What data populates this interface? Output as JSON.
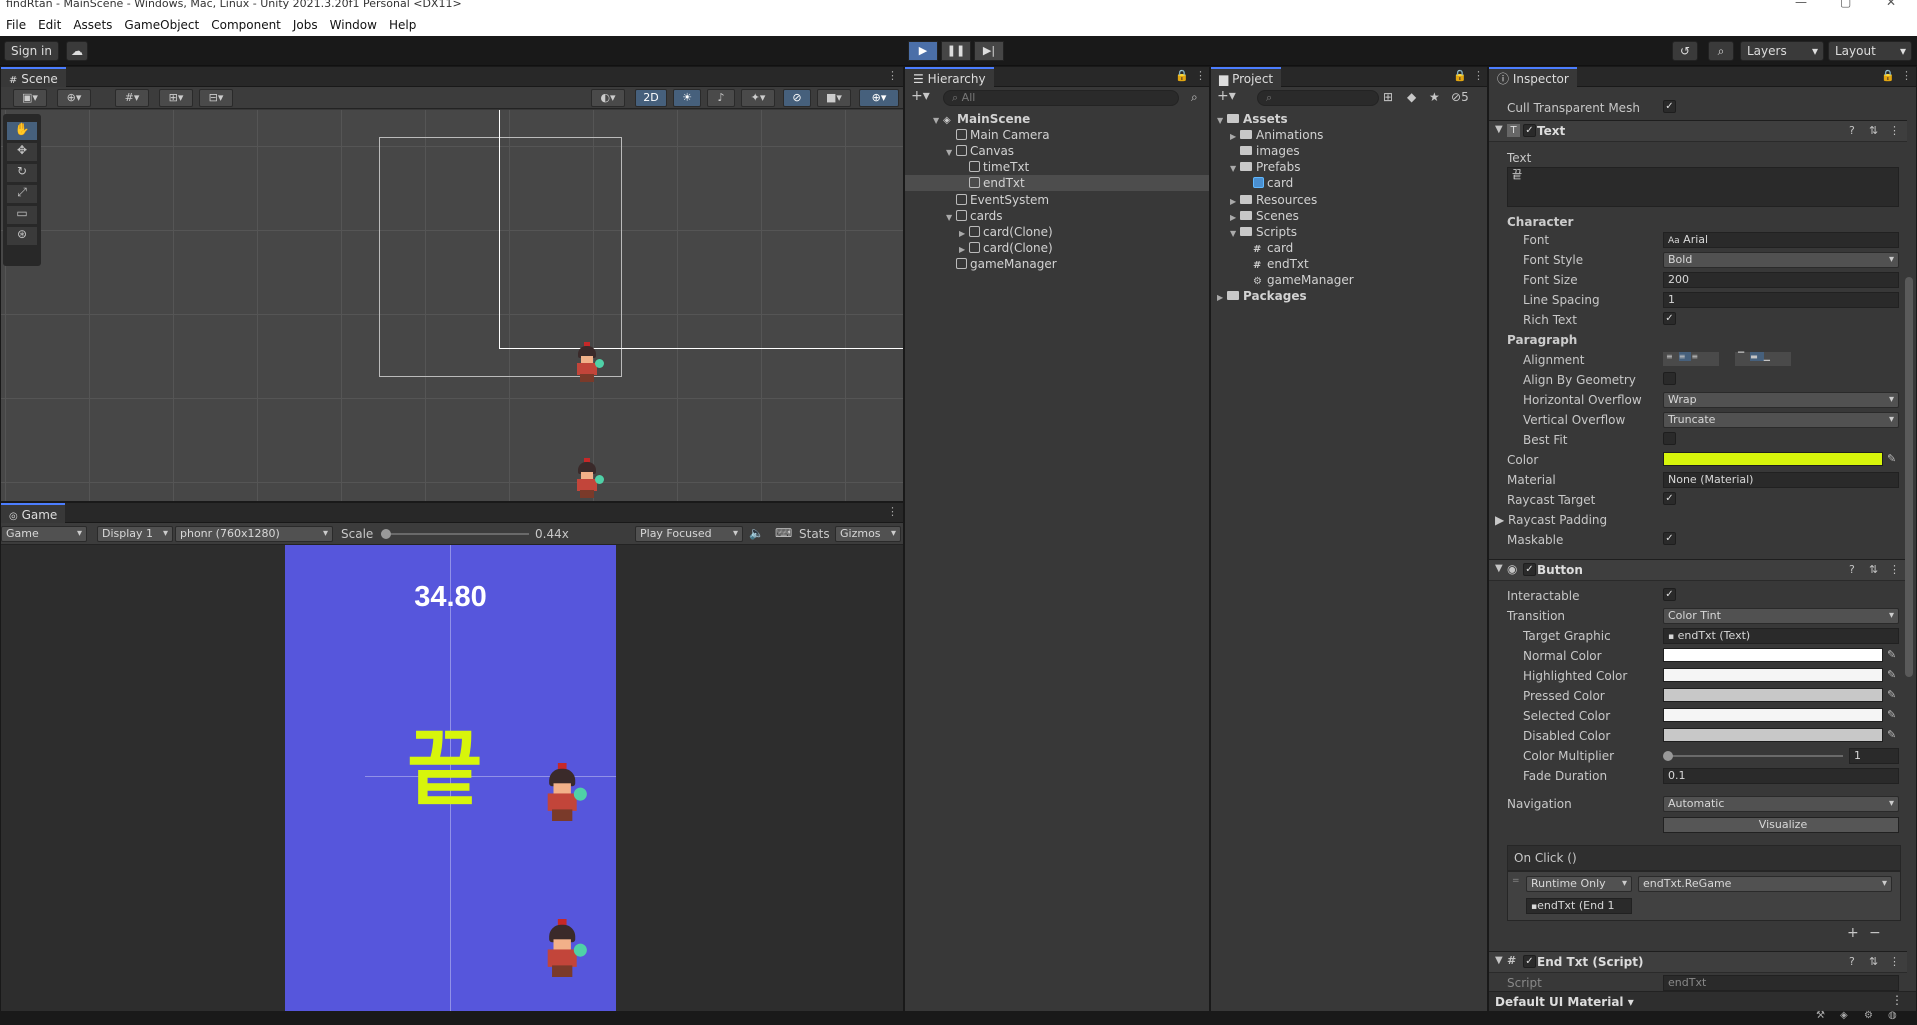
{
  "window": {
    "title": "findRtan - MainScene - Windows, Mac, Linux - Unity 2021.3.20f1 Personal <DX11>"
  },
  "menu": [
    "File",
    "Edit",
    "Assets",
    "GameObject",
    "Component",
    "Jobs",
    "Window",
    "Help"
  ],
  "toolbar": {
    "sign_in": "Sign in",
    "layers": "Layers",
    "layout": "Layout"
  },
  "scene": {
    "tab": "Scene",
    "mode_2d": "2D"
  },
  "game": {
    "tab": "Game",
    "view": "Game",
    "display": "Display 1",
    "resolution": "phonr (760x1280)",
    "scale_label": "Scale",
    "scale_value": "0.44x",
    "scale_fraction": 0.0,
    "play_mode": "Play Focused",
    "stats": "Stats",
    "gizmos": "Gizmos",
    "time_text": "34.80",
    "end_text": "끝",
    "background_color": "#5656dc",
    "end_text_color": "#d7f50b"
  },
  "hierarchy": {
    "tab": "Hierarchy",
    "search_placeholder": "All",
    "items": [
      {
        "label": "MainScene",
        "depth": 0,
        "arrow": "▼",
        "kind": "scene"
      },
      {
        "label": "Main Camera",
        "depth": 1,
        "arrow": "",
        "kind": "obj"
      },
      {
        "label": "Canvas",
        "depth": 1,
        "arrow": "▼",
        "kind": "obj"
      },
      {
        "label": "timeTxt",
        "depth": 2,
        "arrow": "",
        "kind": "obj"
      },
      {
        "label": "endTxt",
        "depth": 2,
        "arrow": "",
        "kind": "obj",
        "selected": true
      },
      {
        "label": "EventSystem",
        "depth": 1,
        "arrow": "",
        "kind": "obj"
      },
      {
        "label": "cards",
        "depth": 1,
        "arrow": "▼",
        "kind": "obj"
      },
      {
        "label": "card(Clone)",
        "depth": 2,
        "arrow": "▶",
        "kind": "obj"
      },
      {
        "label": "card(Clone)",
        "depth": 2,
        "arrow": "▶",
        "kind": "obj"
      },
      {
        "label": "gameManager",
        "depth": 1,
        "arrow": "",
        "kind": "obj"
      }
    ]
  },
  "project": {
    "tab": "Project",
    "hidden_count": "5",
    "items": [
      {
        "label": "Assets",
        "depth": 0,
        "arrow": "▼",
        "kind": "folder",
        "bold": true
      },
      {
        "label": "Animations",
        "depth": 1,
        "arrow": "▶",
        "kind": "folder"
      },
      {
        "label": "images",
        "depth": 1,
        "arrow": "",
        "kind": "folder"
      },
      {
        "label": "Prefabs",
        "depth": 1,
        "arrow": "▼",
        "kind": "folder"
      },
      {
        "label": "card",
        "depth": 2,
        "arrow": "",
        "kind": "prefab"
      },
      {
        "label": "Resources",
        "depth": 1,
        "arrow": "▶",
        "kind": "folder"
      },
      {
        "label": "Scenes",
        "depth": 1,
        "arrow": "▶",
        "kind": "folder"
      },
      {
        "label": "Scripts",
        "depth": 1,
        "arrow": "▼",
        "kind": "folder"
      },
      {
        "label": "card",
        "depth": 2,
        "arrow": "",
        "kind": "script"
      },
      {
        "label": "endTxt",
        "depth": 2,
        "arrow": "",
        "kind": "script"
      },
      {
        "label": "gameManager",
        "depth": 2,
        "arrow": "",
        "kind": "gear"
      },
      {
        "label": "Packages",
        "depth": 0,
        "arrow": "▶",
        "kind": "folder",
        "bold": true
      }
    ]
  },
  "inspector": {
    "tab": "Inspector",
    "cull_label": "Cull Transparent Mesh",
    "text_component": "Text",
    "text_label": "Text",
    "text_value": "끝",
    "character_section": "Character",
    "font_label": "Font",
    "font_value": "Arial",
    "font_style_label": "Font Style",
    "font_style_value": "Bold",
    "font_size_label": "Font Size",
    "font_size_value": "200",
    "line_spacing_label": "Line Spacing",
    "line_spacing_value": "1",
    "rich_text_label": "Rich Text",
    "paragraph_section": "Paragraph",
    "alignment_label": "Alignment",
    "align_geom_label": "Align By Geometry",
    "h_overflow_label": "Horizontal Overflow",
    "h_overflow_value": "Wrap",
    "v_overflow_label": "Vertical Overflow",
    "v_overflow_value": "Truncate",
    "best_fit_label": "Best Fit",
    "color_label": "Color",
    "text_color": "#d7f50b",
    "material_label": "Material",
    "material_value": "None (Material)",
    "raycast_target_label": "Raycast Target",
    "raycast_padding_label": "Raycast Padding",
    "maskable_label": "Maskable",
    "button_component": "Button",
    "interactable_label": "Interactable",
    "transition_label": "Transition",
    "transition_value": "Color Tint",
    "target_graphic_label": "Target Graphic",
    "target_graphic_value": "endTxt (Text)",
    "normal_color_label": "Normal Color",
    "highlighted_color_label": "Highlighted Color",
    "pressed_color_label": "Pressed Color",
    "selected_color_label": "Selected Color",
    "disabled_color_label": "Disabled Color",
    "normal_color": "#ffffff",
    "highlighted_color": "#f5f5f5",
    "pressed_color": "#c8c8c8",
    "selected_color": "#f5f5f5",
    "disabled_color": "#c8c8c8",
    "color_multiplier_label": "Color Multiplier",
    "color_multiplier_value": "1",
    "fade_duration_label": "Fade Duration",
    "fade_duration_value": "0.1",
    "navigation_label": "Navigation",
    "navigation_value": "Automatic",
    "visualize": "Visualize",
    "onclick_label": "On Click ()",
    "runtime_value": "Runtime Only",
    "function_value": "endTxt.ReGame",
    "object_value": "endTxt (End 1",
    "script_component": "End Txt (Script)",
    "script_label": "Script",
    "script_value": "endTxt",
    "footer_material": "Default UI Material"
  }
}
